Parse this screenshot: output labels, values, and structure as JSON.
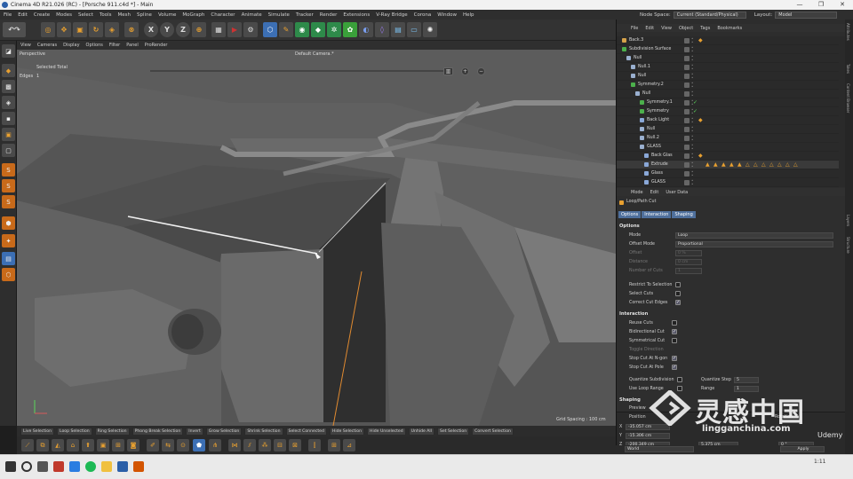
{
  "window": {
    "title": "Cinema 4D R21.026 (RC) - [Porsche 911.c4d *] - Main",
    "controls": [
      "—",
      "❐",
      "✕"
    ]
  },
  "menubar": {
    "items": [
      "File",
      "Edit",
      "Create",
      "Modes",
      "Select",
      "Tools",
      "Mesh",
      "Spline",
      "Volume",
      "MoGraph",
      "Character",
      "Animate",
      "Simulate",
      "Tracker",
      "Render",
      "Extensions",
      "V-Ray Bridge",
      "Corona",
      "Window",
      "Help"
    ],
    "node_space_label": "Node Space:",
    "node_space_value": "Current (Standard/Physical)",
    "layout_label": "Layout:",
    "layout_value": "Model"
  },
  "toolbar": {
    "axis_x": "X",
    "axis_y": "Y",
    "axis_z": "Z"
  },
  "viewport": {
    "menu": [
      "View",
      "Cameras",
      "Display",
      "Options",
      "Filter",
      "Panel",
      "ProRender"
    ],
    "name": "Perspective",
    "camera": "Default Camera.*",
    "selected_label": "Selected Total",
    "edges_label": "Edges",
    "edges_value": "1",
    "grid_spacing": "Grid Spacing : 100 cm"
  },
  "selection_bar": [
    "Live Selection",
    "Loop Selection",
    "Ring Selection",
    "Phong Break Selection",
    "Invert",
    "Grow Selection",
    "Shrink Selection",
    "Select Connected",
    "Hide Selection",
    "Hide Unselected",
    "Unhide All",
    "Set Selection",
    "Convert Selection"
  ],
  "object_manager": {
    "menu": [
      "File",
      "Edit",
      "View",
      "Object",
      "Tags",
      "Bookmarks"
    ],
    "objects": [
      {
        "name": "Back.3",
        "level": 0,
        "color": "#d6a24a"
      },
      {
        "name": "Subdivision Surface",
        "level": 0,
        "color": "#4cb04c"
      },
      {
        "name": "Null",
        "level": 1,
        "color": "#9ab0d0"
      },
      {
        "name": "Null.1",
        "level": 2,
        "color": "#9ab0d0"
      },
      {
        "name": "Null",
        "level": 2,
        "color": "#9ab0d0"
      },
      {
        "name": "Symmetry.2",
        "level": 2,
        "color": "#4cb04c"
      },
      {
        "name": "Null",
        "level": 3,
        "color": "#9ab0d0"
      },
      {
        "name": "Symmetry.1",
        "level": 4,
        "color": "#4cb04c"
      },
      {
        "name": "Symmetry",
        "level": 4,
        "color": "#4cb04c"
      },
      {
        "name": "Back Light",
        "level": 4,
        "color": "#8aa8d8"
      },
      {
        "name": "Null",
        "level": 4,
        "color": "#9ab0d0"
      },
      {
        "name": "Null.2",
        "level": 4,
        "color": "#9ab0d0"
      },
      {
        "name": "GLASS",
        "level": 4,
        "color": "#9ab0d0"
      },
      {
        "name": "Back Glas",
        "level": 5,
        "color": "#8aa8d8"
      },
      {
        "name": "Extrude",
        "level": 5,
        "color": "#8aa8d8"
      },
      {
        "name": "Glass",
        "level": 5,
        "color": "#8aa8d8"
      },
      {
        "name": "GLASS",
        "level": 5,
        "color": "#8aa8d8"
      }
    ]
  },
  "attributes": {
    "menu": [
      "Mode",
      "Edit",
      "User Data"
    ],
    "tool_name": "Loop/Path Cut",
    "tabs": [
      "Options",
      "Interaction",
      "Shaping"
    ],
    "options_title": "Options",
    "mode_label": "Mode",
    "mode_value": "Loop",
    "offset_mode_label": "Offset Mode",
    "offset_mode_value": "Proportional",
    "offset_label": "Offset",
    "offset_value": "0 %",
    "distance_label": "Distance",
    "distance_value": "0 cm",
    "num_cuts_label": "Number of Cuts",
    "num_cuts_value": "1",
    "restrict_label": "Restrict To Selection",
    "select_cuts_label": "Select Cuts",
    "correct_edges_label": "Correct Cut Edges",
    "interaction_title": "Interaction",
    "reuse_label": "Reuse Cuts",
    "bidirectional_label": "Bidirectional Cut",
    "symmetrical_label": "Symmetrical Cut",
    "toggle_dir_label": "Toggle Direction",
    "stop_ngon_label": "Stop Cut At N-gon",
    "stop_pole_label": "Stop Cut At Pole",
    "quantize_label": "Quantize Subdivision",
    "quantize_step_label": "Quantize Step",
    "quantize_step_value": "5",
    "loop_range_label": "Use Loop Range",
    "range_label": "Range",
    "range_value": "1",
    "shaping_title": "Shaping",
    "shaping_sub": "Preview"
  },
  "coordinates": {
    "position_label": "Position",
    "rotation_label": "Rotation",
    "x_label": "X",
    "y_label": "Y",
    "z_label": "Z",
    "x_pos": "-35.057 cm",
    "y_pos": "-15.306 cm",
    "z_pos": "-200.349 cm",
    "size_z": "5.375 cm",
    "rot_b": "0 °",
    "world": "World",
    "apply": "Apply"
  },
  "sidetabs": [
    "Attributes",
    "Takes",
    "Content Browser",
    "Layers",
    "Structure"
  ],
  "watermark": {
    "text": "灵感中国",
    "url": "lingganchina.com",
    "brand": "Udemy"
  },
  "taskbar": {
    "time": "1:11"
  }
}
